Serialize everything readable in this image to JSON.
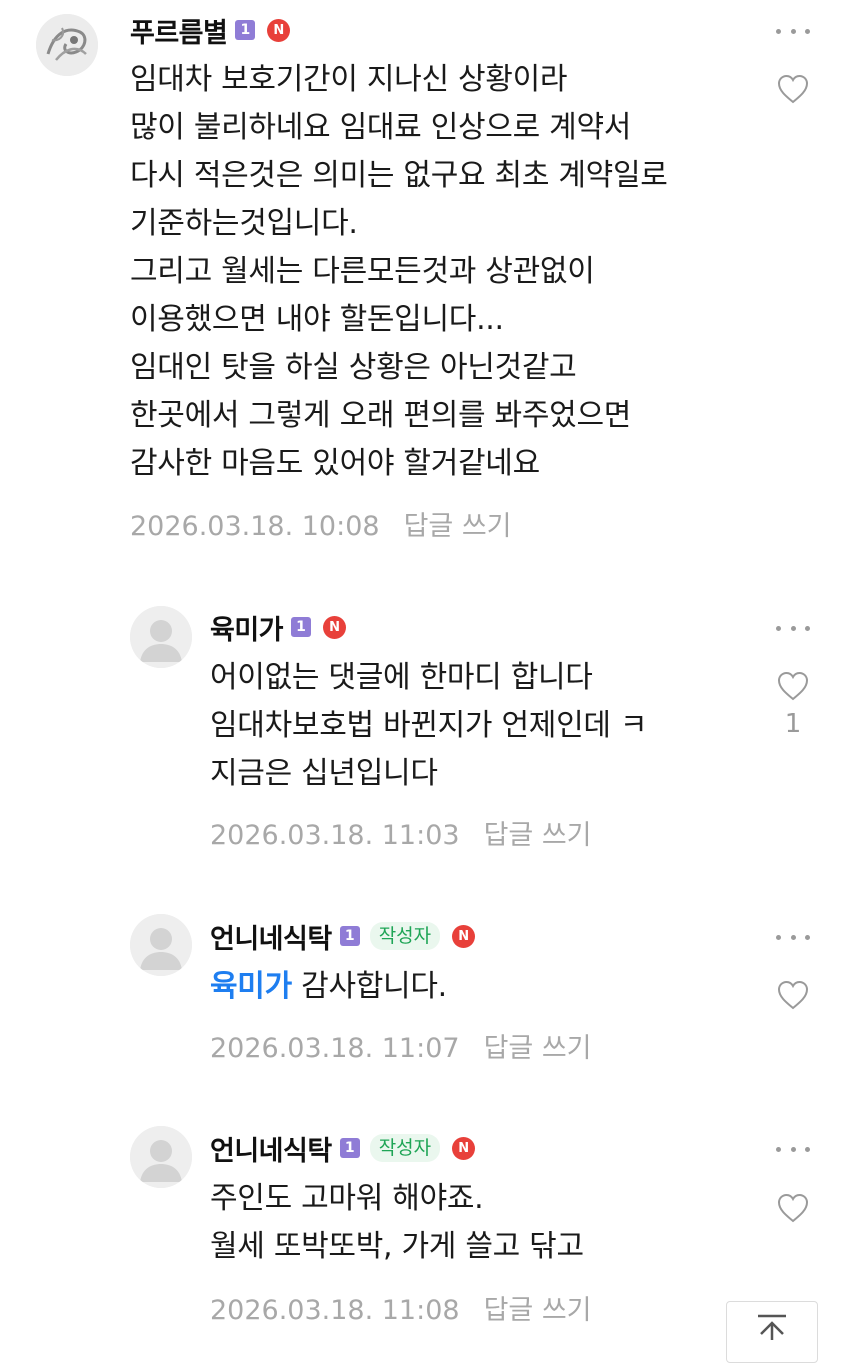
{
  "comments": [
    {
      "nickname": "푸르름별",
      "level": "1",
      "new_badge": "N",
      "lines": [
        "임대차 보호기간이 지나신 상황이라",
        "많이 불리하네요 임대료 인상으로 계약서",
        "다시 적은것은 의미는 없구요 최초 계약일로",
        "기준하는것입니다.",
        "그리고 월세는 다른모든것과 상관없이",
        "이용했으면 내야 할돈입니다...",
        "임대인 탓을 하실 상황은 아닌것같고",
        "한곳에서 그렇게 오래 편의를 봐주었으면",
        "감사한 마음도 있어야 할거같네요"
      ],
      "timestamp": "2026.03.18. 10:08",
      "reply_label": "답글 쓰기"
    },
    {
      "nickname": "육미가",
      "level": "1",
      "new_badge": "N",
      "lines": [
        "어이없는 댓글에 한마디 합니다",
        "임대차보호법 바뀐지가 언제인데 ㅋ",
        "지금은 십년입니다"
      ],
      "like_count": "1",
      "timestamp": "2026.03.18. 11:03",
      "reply_label": "답글 쓰기"
    },
    {
      "nickname": "언니네식탁",
      "level": "1",
      "writer_badge": "작성자",
      "new_badge": "N",
      "mention": "육미가",
      "text": " 감사합니다.",
      "timestamp": "2026.03.18. 11:07",
      "reply_label": "답글 쓰기"
    },
    {
      "nickname": "언니네식탁",
      "level": "1",
      "writer_badge": "작성자",
      "new_badge": "N",
      "lines": [
        "주인도 고마워 해야죠.",
        "월세 또박또박, 가게 쓸고 닦고"
      ],
      "timestamp": "2026.03.18. 11:08",
      "reply_label": "답글 쓰기"
    }
  ],
  "icons": {
    "like": "heart-outline-icon",
    "more": "more-dots-icon",
    "scroll_top": "arrow-up-to-top-icon"
  },
  "colors": {
    "mention": "#1e7ef0",
    "new_badge": "#e8403a",
    "level_badge": "#8f7cd6",
    "writer_badge_text": "#1fa556",
    "meta_text": "#a8a8a8"
  }
}
